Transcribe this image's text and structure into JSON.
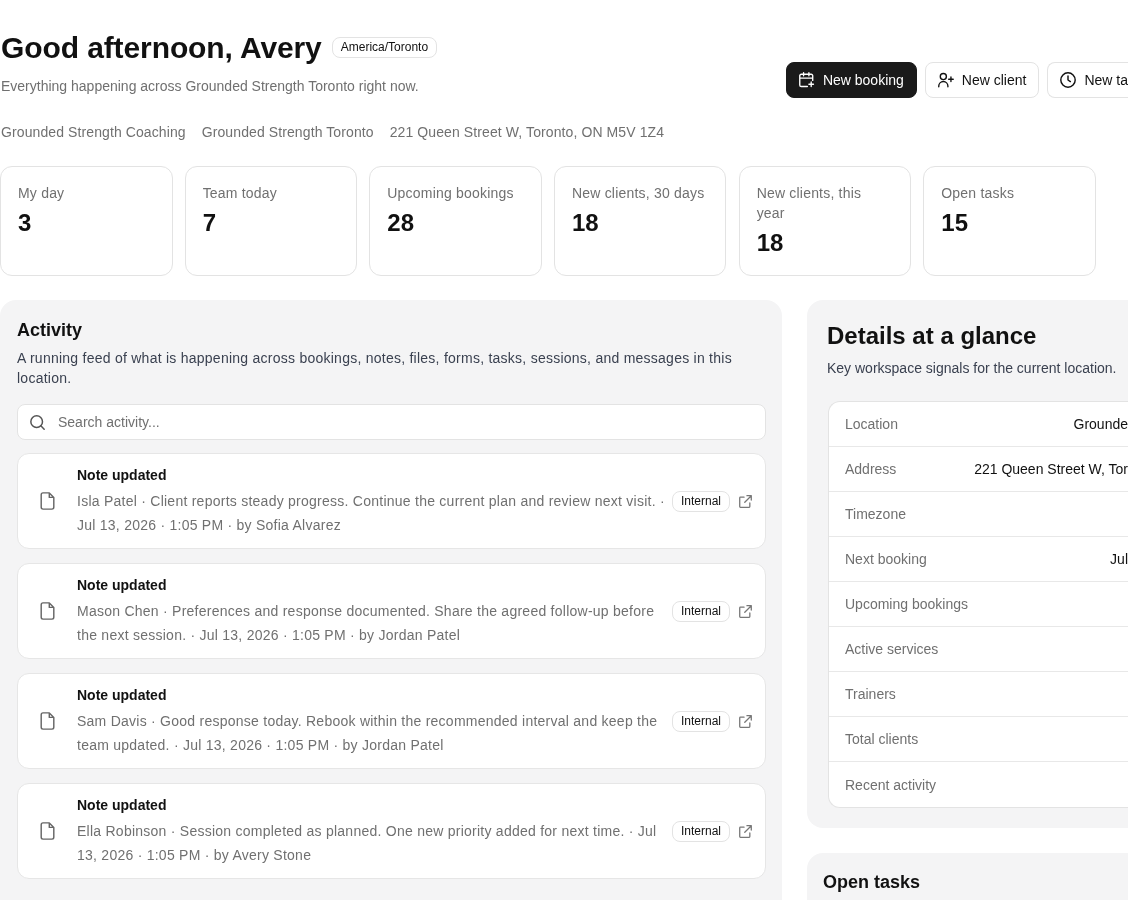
{
  "header": {
    "title": "Good afternoon, Avery",
    "timezone_badge": "America/Toronto",
    "subtitle": "Everything happening across Grounded Strength Toronto right now.",
    "actions": [
      {
        "label": "New booking",
        "primary": true
      },
      {
        "label": "New client",
        "primary": false
      },
      {
        "label": "New ta",
        "primary": false
      }
    ]
  },
  "meta": [
    "Grounded Strength Coaching",
    "Grounded Strength Toronto",
    "221 Queen Street W, Toronto, ON M5V 1Z4"
  ],
  "stats": [
    {
      "label": "My day",
      "value": "3"
    },
    {
      "label": "Team today",
      "value": "7"
    },
    {
      "label": "Upcoming bookings",
      "value": "28"
    },
    {
      "label": "New clients, 30 days",
      "value": "18"
    },
    {
      "label": "New clients, this year",
      "value": "18"
    },
    {
      "label": "Open tasks",
      "value": "15"
    }
  ],
  "activity": {
    "title": "Activity",
    "description": "A running feed of what is happening across bookings, notes, files, forms, tasks, sessions, and messages in this location.",
    "search": {
      "placeholder": "Search activity..."
    },
    "items": [
      {
        "title": "Note updated",
        "text": "Isla Patel · Client reports steady progress. Continue the current plan and review next visit. · Jul 13, 2026 · 1:05 PM · by Sofia Alvarez",
        "badge": "Internal"
      },
      {
        "title": "Note updated",
        "text": "Mason Chen · Preferences and response documented. Share the agreed follow-up before the next session. · Jul 13, 2026 · 1:05 PM · by Jordan Patel",
        "badge": "Internal"
      },
      {
        "title": "Note updated",
        "text": "Sam Davis · Good response today. Rebook within the recommended interval and keep the team updated. · Jul 13, 2026 · 1:05 PM · by Jordan Patel",
        "badge": "Internal"
      },
      {
        "title": "Note updated",
        "text": "Ella Robinson · Session completed as planned. One new priority added for next time. · Jul 13, 2026 · 1:05 PM · by Avery Stone",
        "badge": "Internal"
      }
    ]
  },
  "details": {
    "title": "Details at a glance",
    "description": "Key workspace signals for the current location.",
    "rows": [
      {
        "label": "Location",
        "value": "Grounde"
      },
      {
        "label": "Address",
        "value": "221 Queen Street W, Tor"
      },
      {
        "label": "Timezone"
      },
      {
        "label": "Next booking",
        "value": "Jul"
      },
      {
        "label": "Upcoming bookings"
      },
      {
        "label": "Active services"
      },
      {
        "label": "Trainers"
      },
      {
        "label": "Total clients"
      },
      {
        "label": "Recent activity"
      }
    ]
  },
  "open_tasks": {
    "title": "Open tasks"
  }
}
